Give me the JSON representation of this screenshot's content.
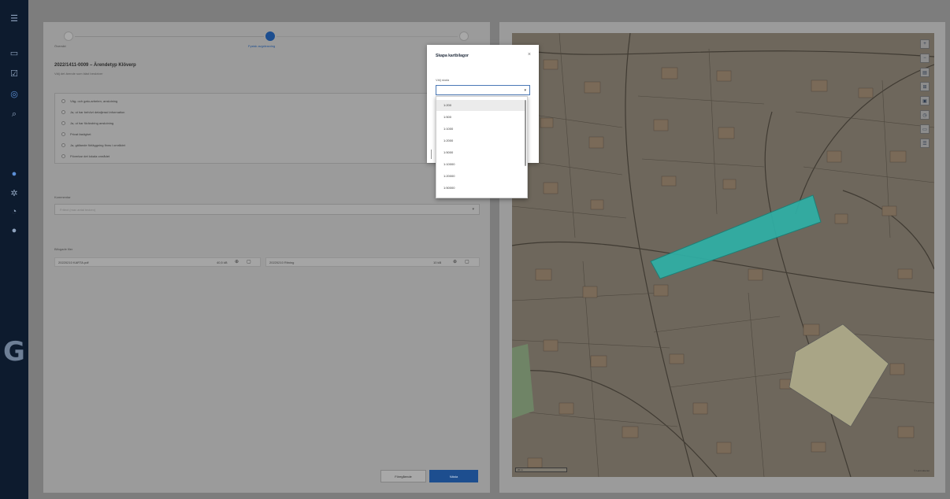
{
  "sidebar": {
    "icons": [
      "menu-icon",
      "document-icon",
      "checklist-icon",
      "map-pin-icon",
      "search-icon",
      "circle-icon",
      "settings-icon",
      "help-icon",
      "user-icon"
    ],
    "logo": "G"
  },
  "stepper": {
    "steps": [
      {
        "label": "Översikt"
      },
      {
        "label": "Fysisk avgränsning"
      },
      {
        "label": ""
      }
    ],
    "current": 2
  },
  "case": {
    "title": "2022/1411-0009 – Ärendetyp Klöverp",
    "subtitle": "Välj det ärende som bäst beskriver"
  },
  "reasons": [
    "Väg- och gatu-arbeten, anslutning",
    "Ja, ut har behövt detaljerad information",
    "Ja, ut har förändring anslutning",
    "Privat fastighet",
    "Ja, gällande förläggning finns i området",
    "Pöverkar det lokala området"
  ],
  "comment": {
    "label": "Kommentar",
    "placeholder": "Fritext (max antal tecken)"
  },
  "attachments": {
    "label": "Bifogade filer",
    "files": [
      {
        "name": "20220210 KARTA.pdf",
        "size": "40,5 kB"
      },
      {
        "name": "20220210 Ritning",
        "size": "10 kB"
      }
    ]
  },
  "buttons": {
    "previous": "Föregående",
    "next": "Nästa"
  },
  "map": {
    "tools": [
      "zoom-in-icon",
      "zoom-out-icon",
      "layers-icon",
      "measure-icon",
      "draw-icon",
      "clock-icon",
      "print-icon",
      "legend-icon"
    ],
    "scale_text": "20 m",
    "attribution": "© Lantmäteriet"
  },
  "dialog": {
    "title": "Skapa kartbilagor",
    "close": "×",
    "field_label": "Välj skala",
    "selected_value": "",
    "options": [
      "1:200",
      "1:500",
      "1:1000",
      "1:2000",
      "1:5000",
      "1:10000",
      "1:20000",
      "1:50000"
    ],
    "highlighted_index": 0
  },
  "colors": {
    "sidebar": "#0d1b2e",
    "accent": "#1d4e8f",
    "selection": "#2fb0a6",
    "map_base": "#6e675c",
    "highlight_plot": "#a9a586"
  }
}
